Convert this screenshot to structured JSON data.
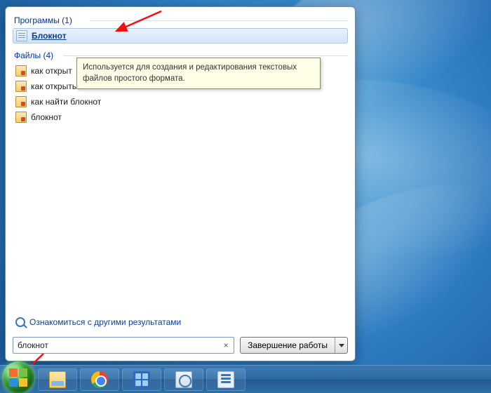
{
  "groups": {
    "programs": {
      "label": "Программы (1)"
    },
    "files": {
      "label": "Файлы (4)"
    }
  },
  "program_item": {
    "label": "Блокнот"
  },
  "file_items": [
    {
      "label": "как открыть блокнот"
    },
    {
      "label": "как открыть блокнот"
    },
    {
      "label": "как найти блокнот"
    },
    {
      "label": "блокнот"
    }
  ],
  "file_item_truncated": "как открыт",
  "tooltip": "Используется для создания и редактирования текстовых файлов простого формата.",
  "more_results": "Ознакомиться с другими результатами",
  "search": {
    "value": "блокнот"
  },
  "shutdown": {
    "label": "Завершение работы"
  }
}
